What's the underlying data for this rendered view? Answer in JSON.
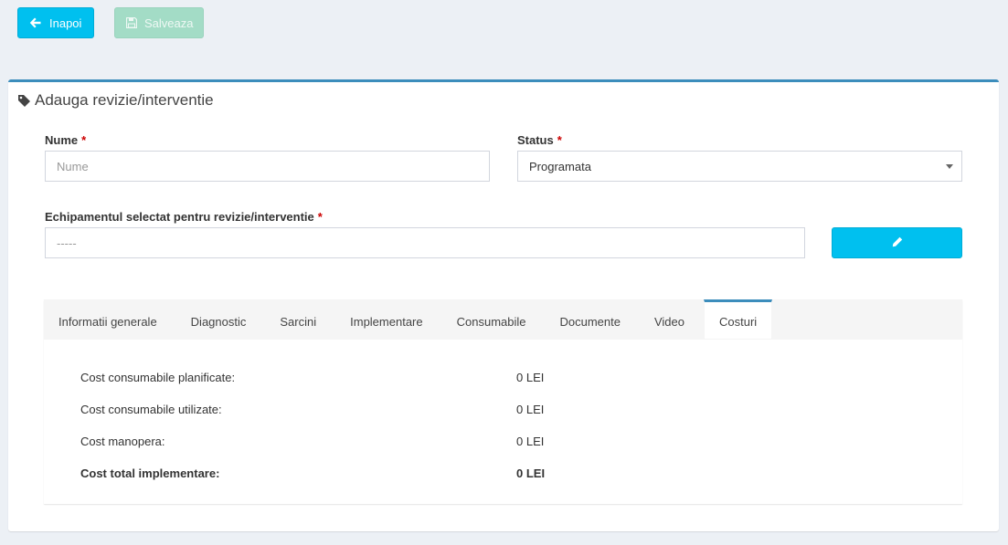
{
  "toolbar": {
    "back_label": "Inapoi",
    "save_label": "Salveaza"
  },
  "box": {
    "title": "Adauga revizie/interventie"
  },
  "form": {
    "name_label": "Nume",
    "name_placeholder": "Nume",
    "status_label": "Status",
    "status_value": "Programata",
    "equipment_label": "Echipamentul selectat pentru revizie/interventie",
    "equipment_value": "-----",
    "required_mark": "*"
  },
  "tabs": [
    {
      "label": "Informatii generale",
      "active": false
    },
    {
      "label": "Diagnostic",
      "active": false
    },
    {
      "label": "Sarcini",
      "active": false
    },
    {
      "label": "Implementare",
      "active": false
    },
    {
      "label": "Consumabile",
      "active": false
    },
    {
      "label": "Documente",
      "active": false
    },
    {
      "label": "Video",
      "active": false
    },
    {
      "label": "Costuri",
      "active": true
    }
  ],
  "costs": [
    {
      "label": "Cost consumabile planificate:",
      "value": "0 LEI"
    },
    {
      "label": "Cost consumabile utilizate:",
      "value": "0 LEI"
    },
    {
      "label": "Cost manopera:",
      "value": "0 LEI"
    },
    {
      "label": "Cost total implementare:",
      "value": "0 LEI"
    }
  ],
  "colors": {
    "primary": "#00c0ef",
    "success_disabled": "#a3dcc6",
    "box_border": "#3c8dbc",
    "required": "#cc0000"
  },
  "icons": {
    "back": "arrow-left-icon",
    "save": "floppy-disk-icon",
    "title": "tag-icon",
    "edit": "pencil-icon"
  }
}
